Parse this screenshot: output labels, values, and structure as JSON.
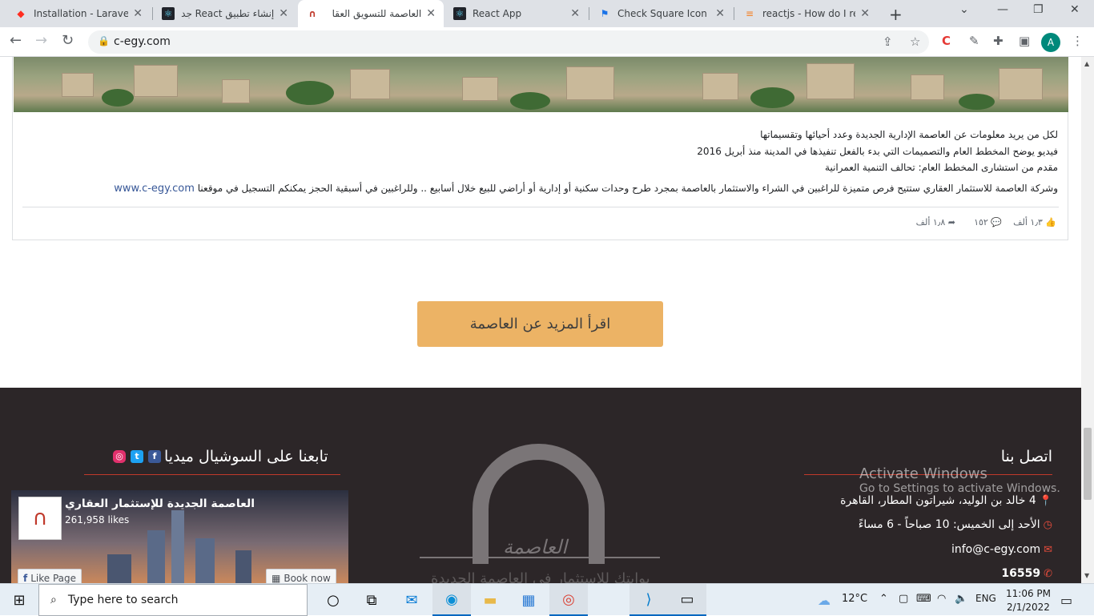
{
  "browser": {
    "tabs": [
      {
        "title": "Installation - Laravel -",
        "favicon": "laravel-icon",
        "active": false
      },
      {
        "title": "إنشاء تطبيق React جديد",
        "favicon": "react-icon",
        "active": false
      },
      {
        "title": "العاصمة للتسويق العقا",
        "favicon": "c-egy-icon",
        "active": true
      },
      {
        "title": "React App",
        "favicon": "react-icon",
        "active": false
      },
      {
        "title": "Check Square Icon - R",
        "favicon": "flag-icon",
        "active": false
      },
      {
        "title": "reactjs - How do I refe",
        "favicon": "stackoverflow-icon",
        "active": false
      }
    ],
    "url": "c-egy.com",
    "profile_initial": "A"
  },
  "post": {
    "line1": "لكل من يريد معلومات عن العاصمة الإدارية الجديدة وعدد أحيائها وتقسيماتها",
    "line2": "فيديو يوضح المخطط العام والتصميمات التي بدء بالفعل تنفيذها في المدينة منذ أبريل 2016",
    "line3": "مقدم من استشارى المخطط العام: تحالف التنمية العمرانية",
    "line4": "وشركة العاصمة للاستثمار العقاري ستتيح فرص متميزة للراغبين في الشراء والاستثمار بالعاصمة بمجرد طرح وحدات سكنية أو إدارية أو أراضي للبيع خلال أسابيع .. وللراغبين في أسبقية الحجز يمكنكم التسجيل في موقعنا",
    "link": "www.c-egy.com",
    "likes": "١٫٣ ألف",
    "comments": "١٥٢",
    "shares": "١٫٨ ألف"
  },
  "read_more_label": "اقرأ المزيد عن العاصمة",
  "footer": {
    "contact_title": "اتصل بنا",
    "address": "4 خالد بن الوليد، شيراتون المطار، القاهرة",
    "hours": "الأحد إلى الخميس: 10 صباحاً - 6 مساءً",
    "email": "info@c-egy.com",
    "phone": "16559",
    "social_title": "تابعنا على السوشيال ميديا",
    "logo_name": "العاصمة",
    "slogan": "بوابتك للاستثمار في العاصمة الجديدة",
    "fb_page_name": "العاصمة الجديدة للإستثمار العقاري",
    "fb_likes": "261,958 likes",
    "fb_like_page": "Like Page",
    "fb_book_now": "Book now",
    "accent_color": "#e74c3c",
    "button_color": "#ecb365"
  },
  "watermark": {
    "line1": "Activate Windows",
    "line2": "Go to Settings to activate Windows."
  },
  "taskbar": {
    "search_placeholder": "Type here to search",
    "temperature": "12°C",
    "language": "ENG",
    "time": "11:06 PM",
    "date": "2/1/2022"
  }
}
